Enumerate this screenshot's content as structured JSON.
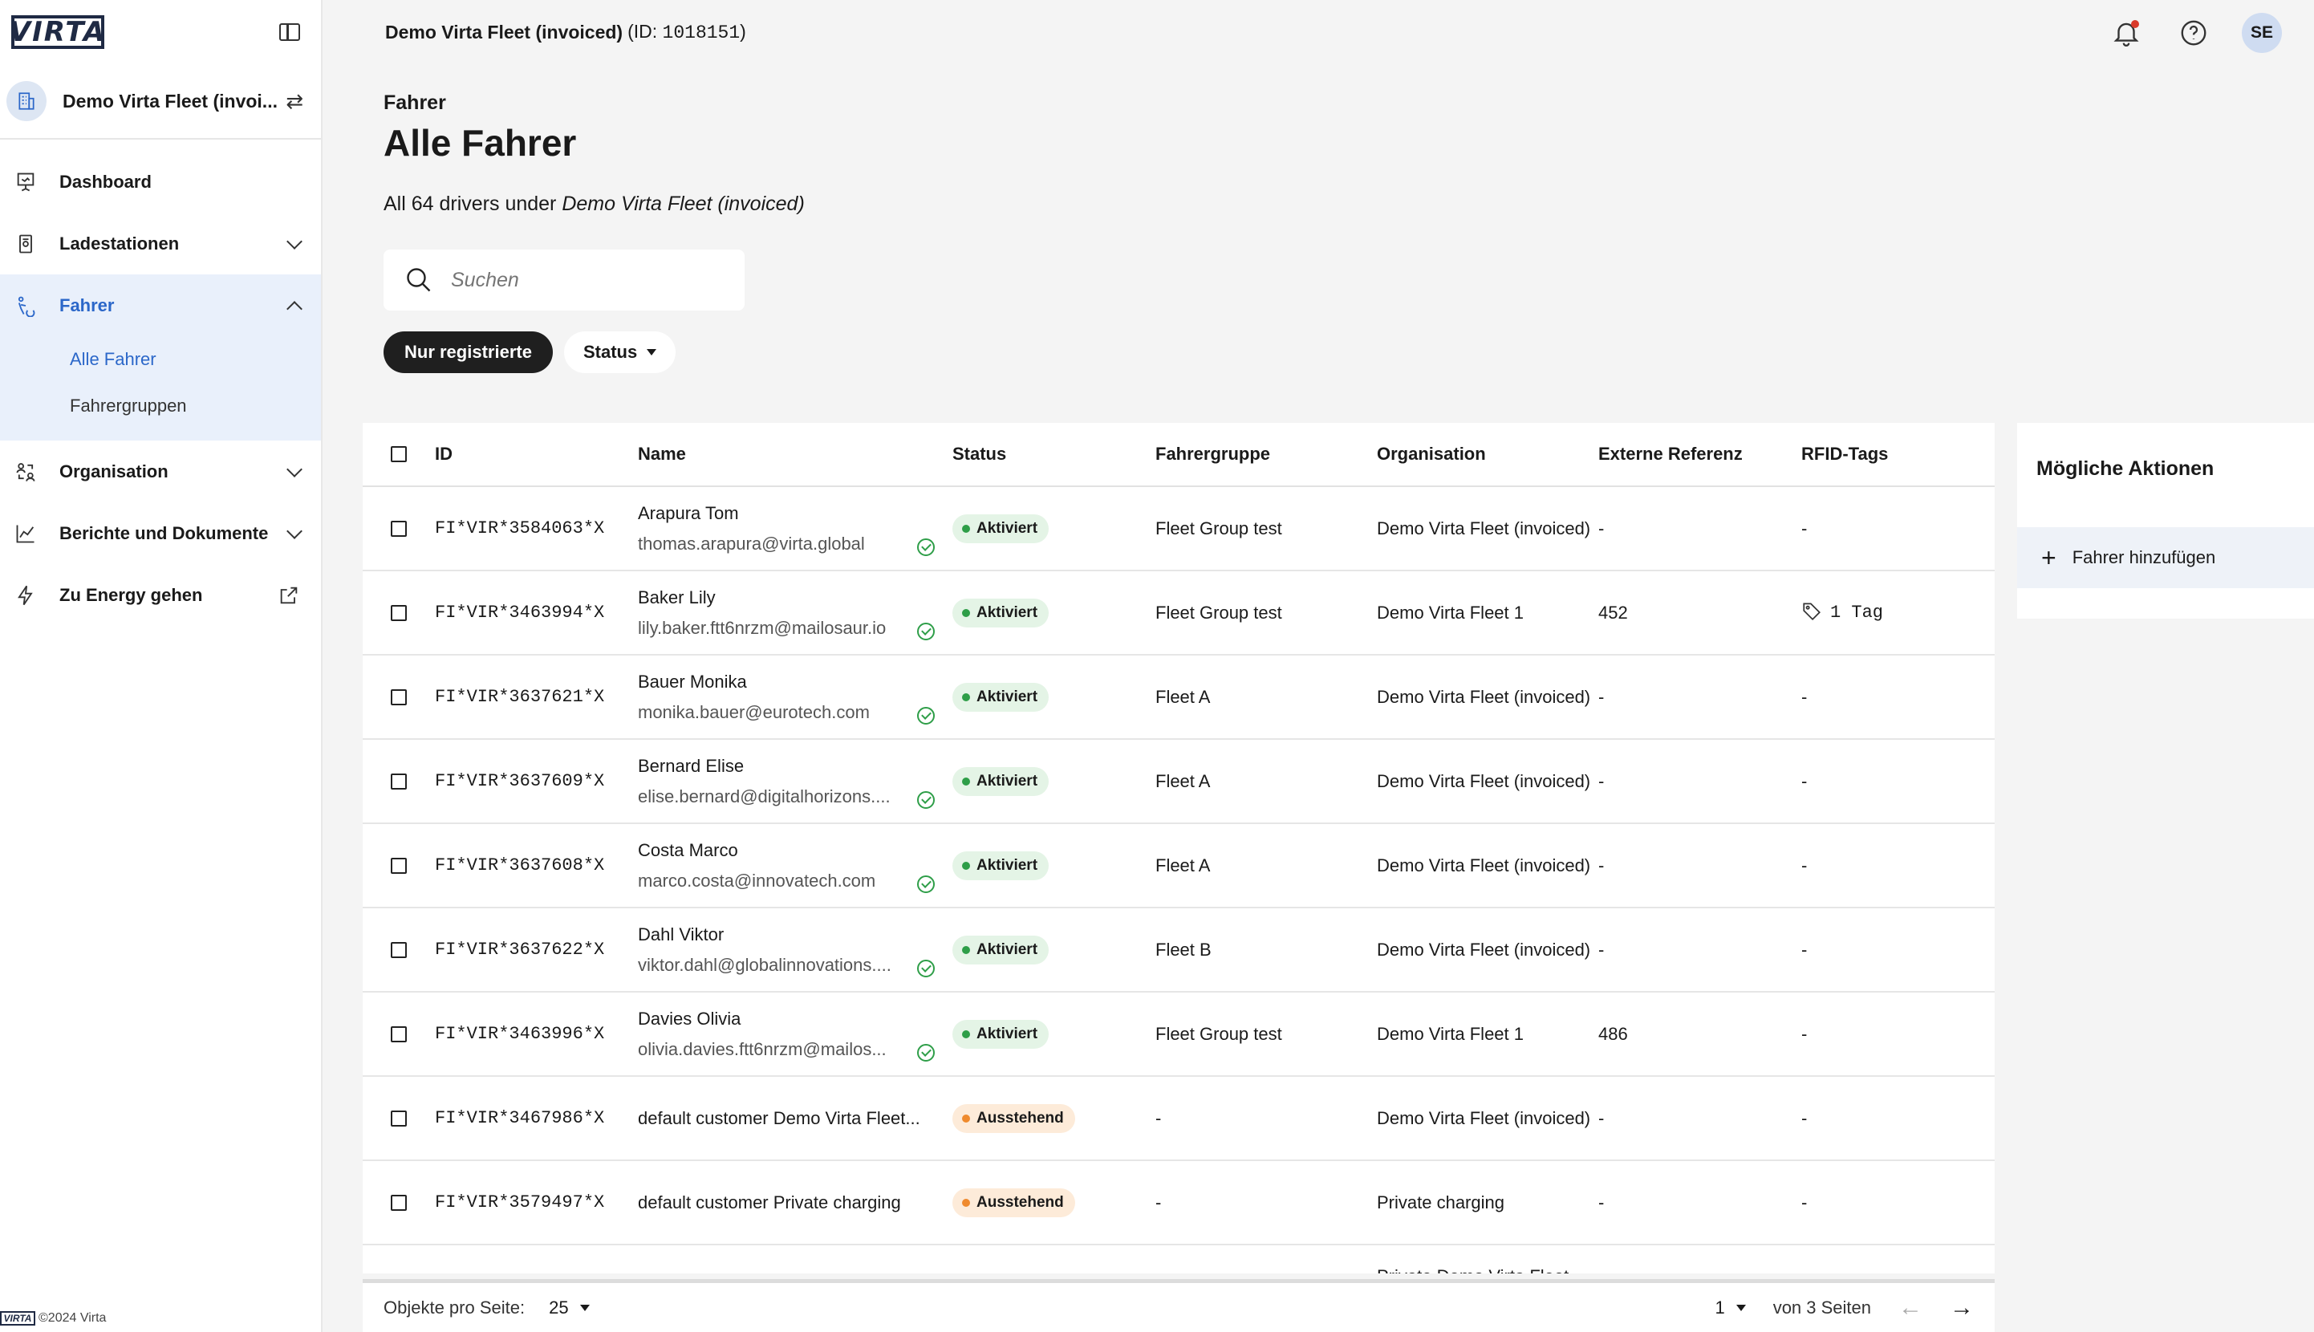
{
  "app": {
    "logo_text": "VIRTA",
    "footer": "©2024 Virta"
  },
  "sidebar": {
    "org_name": "Demo Virta Fleet (invoi...",
    "items": [
      {
        "label": "Dashboard",
        "icon": "presentation-icon"
      },
      {
        "label": "Ladestationen",
        "icon": "charger-icon"
      },
      {
        "label": "Fahrer",
        "icon": "driver-icon"
      },
      {
        "label": "Organisation",
        "icon": "organisation-icon"
      },
      {
        "label": "Berichte und Dokumente",
        "icon": "chart-icon"
      },
      {
        "label": "Zu Energy gehen",
        "icon": "bolt-icon"
      }
    ],
    "sub_items": [
      "Alle Fahrer",
      "Fahrergruppen"
    ]
  },
  "topbar": {
    "fleet": "Demo Virta Fleet (invoiced)",
    "id_prefix": "(ID:",
    "id_value": "1018151",
    "id_suffix": ")",
    "avatar": "SE"
  },
  "page": {
    "breadcrumb": "Fahrer",
    "title": "Alle Fahrer",
    "subtitle_prefix": "All 64 drivers under",
    "subtitle_org": "Demo Virta Fleet (invoiced)"
  },
  "search": {
    "placeholder": "Suchen"
  },
  "filters": {
    "registered": "Nur registrierte",
    "status": "Status"
  },
  "table": {
    "headers": [
      "ID",
      "Name",
      "Status",
      "Fahrergruppe",
      "Organisation",
      "Externe Referenz",
      "RFID-Tags"
    ],
    "rows": [
      {
        "id": "FI*VIR*3584063*X",
        "name": "Arapura Tom",
        "email": "thomas.arapura@virta.global",
        "status": "Aktiviert",
        "group": "Fleet Group test",
        "org": "Demo Virta Fleet (invoiced)",
        "ext": "-",
        "rfid": "-"
      },
      {
        "id": "FI*VIR*3463994*X",
        "name": "Baker Lily",
        "email": "lily.baker.ftt6nrzm@mailosaur.io",
        "status": "Aktiviert",
        "group": "Fleet Group test",
        "org": "Demo Virta Fleet 1",
        "ext": "452",
        "rfid": "1 Tag"
      },
      {
        "id": "FI*VIR*3637621*X",
        "name": "Bauer Monika",
        "email": "monika.bauer@eurotech.com",
        "status": "Aktiviert",
        "group": "Fleet A",
        "org": "Demo Virta Fleet (invoiced)",
        "ext": "-",
        "rfid": "-"
      },
      {
        "id": "FI*VIR*3637609*X",
        "name": "Bernard Elise",
        "email": "elise.bernard@digitalhorizons....",
        "status": "Aktiviert",
        "group": "Fleet A",
        "org": "Demo Virta Fleet (invoiced)",
        "ext": "-",
        "rfid": "-"
      },
      {
        "id": "FI*VIR*3637608*X",
        "name": "Costa Marco",
        "email": "marco.costa@innovatech.com",
        "status": "Aktiviert",
        "group": "Fleet A",
        "org": "Demo Virta Fleet (invoiced)",
        "ext": "-",
        "rfid": "-"
      },
      {
        "id": "FI*VIR*3637622*X",
        "name": "Dahl Viktor",
        "email": "viktor.dahl@globalinnovations....",
        "status": "Aktiviert",
        "group": "Fleet B",
        "org": "Demo Virta Fleet (invoiced)",
        "ext": "-",
        "rfid": "-"
      },
      {
        "id": "FI*VIR*3463996*X",
        "name": "Davies Olivia",
        "email": "olivia.davies.ftt6nrzm@mailos...",
        "status": "Aktiviert",
        "group": "Fleet Group test",
        "org": "Demo Virta Fleet 1",
        "ext": "486",
        "rfid": "-"
      },
      {
        "id": "FI*VIR*3467986*X",
        "name": "default customer Demo Virta Fleet...",
        "email": "",
        "status": "Ausstehend",
        "group": "-",
        "org": "Demo Virta Fleet (invoiced)",
        "ext": "-",
        "rfid": "-"
      },
      {
        "id": "FI*VIR*3579497*X",
        "name": "default customer Private charging",
        "email": "",
        "status": "Ausstehend",
        "group": "-",
        "org": "Private charging",
        "ext": "-",
        "rfid": "-"
      }
    ],
    "partial_row_org": "Private Demo Virta Fleet"
  },
  "pagination": {
    "per_page_label": "Objekte pro Seite:",
    "per_page": "25",
    "page": "1",
    "of_pages": "von 3 Seiten"
  },
  "actions": {
    "title": "Mögliche Aktionen",
    "add_driver": "Fahrer hinzufügen"
  }
}
